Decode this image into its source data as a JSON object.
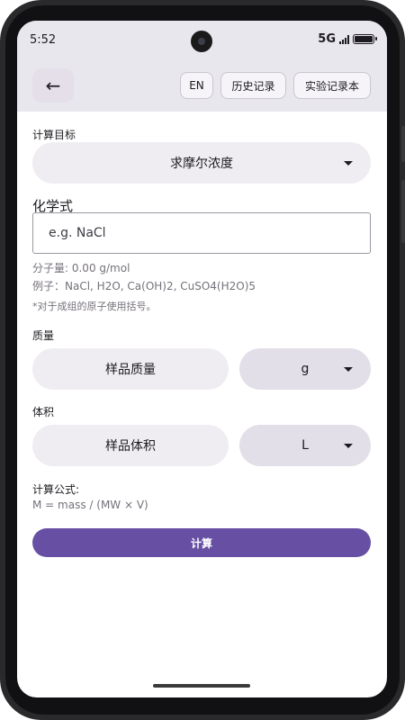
{
  "status_bar": {
    "time": "5:52",
    "network": "5G"
  },
  "app_bar": {
    "back_icon": "←",
    "lang_button": "EN",
    "history_button": "历史记录",
    "notebook_button": "实验记录本"
  },
  "target": {
    "label": "计算目标",
    "selected": "求摩尔浓度"
  },
  "formula": {
    "label": "化学式",
    "placeholder": "e.g. NaCl",
    "molar_mass": "分子量: 0.00 g/mol",
    "example": "例子：NaCl, H2O, Ca(OH)2, CuSO4(H2O)5",
    "note": "*对于成组的原子使用括号。"
  },
  "mass": {
    "label": "质量",
    "placeholder": "样品质量",
    "unit": "g"
  },
  "volume": {
    "label": "体积",
    "placeholder": "样品体积",
    "unit": "L"
  },
  "calc_formula": {
    "label": "计算公式:",
    "expression": "M = mass / (MW × V)"
  },
  "calculate_button": "计算",
  "colors": {
    "accent": "#6750a4",
    "surface": "#e9e7ee",
    "field": "#efedf1"
  }
}
